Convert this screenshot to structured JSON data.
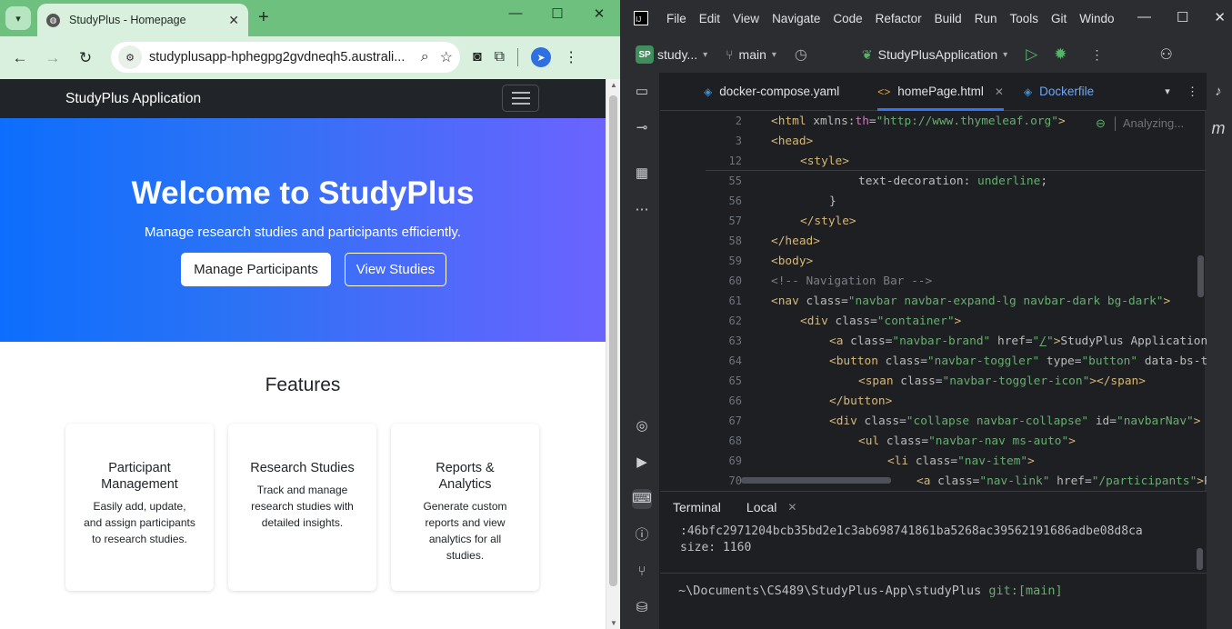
{
  "browser": {
    "tab_title": "StudyPlus - Homepage",
    "url": "studyplusapp-hphegpg2gvdneqh5.australi..."
  },
  "site": {
    "brand": "StudyPlus Application",
    "hero": {
      "title": "Welcome to StudyPlus",
      "subtitle": "Manage research studies and participants efficiently.",
      "btn_primary": "Manage Participants",
      "btn_secondary": "View Studies"
    },
    "features": {
      "heading": "Features",
      "cards": [
        {
          "title": "Participant Management",
          "text": "Easily add, update, and assign participants to research studies."
        },
        {
          "title": "Research Studies",
          "text": "Track and manage research studies with detailed insights."
        },
        {
          "title": "Reports & Analytics",
          "text": "Generate custom reports and view analytics for all studies."
        }
      ]
    }
  },
  "ide": {
    "menu": [
      "File",
      "Edit",
      "View",
      "Navigate",
      "Code",
      "Refactor",
      "Build",
      "Run",
      "Tools",
      "Git",
      "Windo"
    ],
    "project_badge": "SP",
    "project": "study...",
    "branch": "main",
    "run_config": "StudyPlusApplication",
    "tabs": [
      "docker-compose.yaml",
      "homePage.html",
      "Dockerfile"
    ],
    "analyzing": "Analyzing...",
    "line_numbers": [
      "2",
      "3",
      "12",
      "55",
      "56",
      "57",
      "58",
      "59",
      "60",
      "61",
      "62",
      "63",
      "64",
      "65",
      "66",
      "67",
      "68",
      "69",
      "70"
    ],
    "terminal": {
      "title": "Terminal",
      "tab": "Local",
      "hash_line": ":46bfc2971204bcb35bd2e1c3ab698741861ba5268ac39562191686adbe08d8ca",
      "size_line": "size: 1160",
      "prompt_path": "~\\Documents\\CS489\\StudyPlus-App\\studyPlus",
      "prompt_git": "git:[main]"
    }
  }
}
